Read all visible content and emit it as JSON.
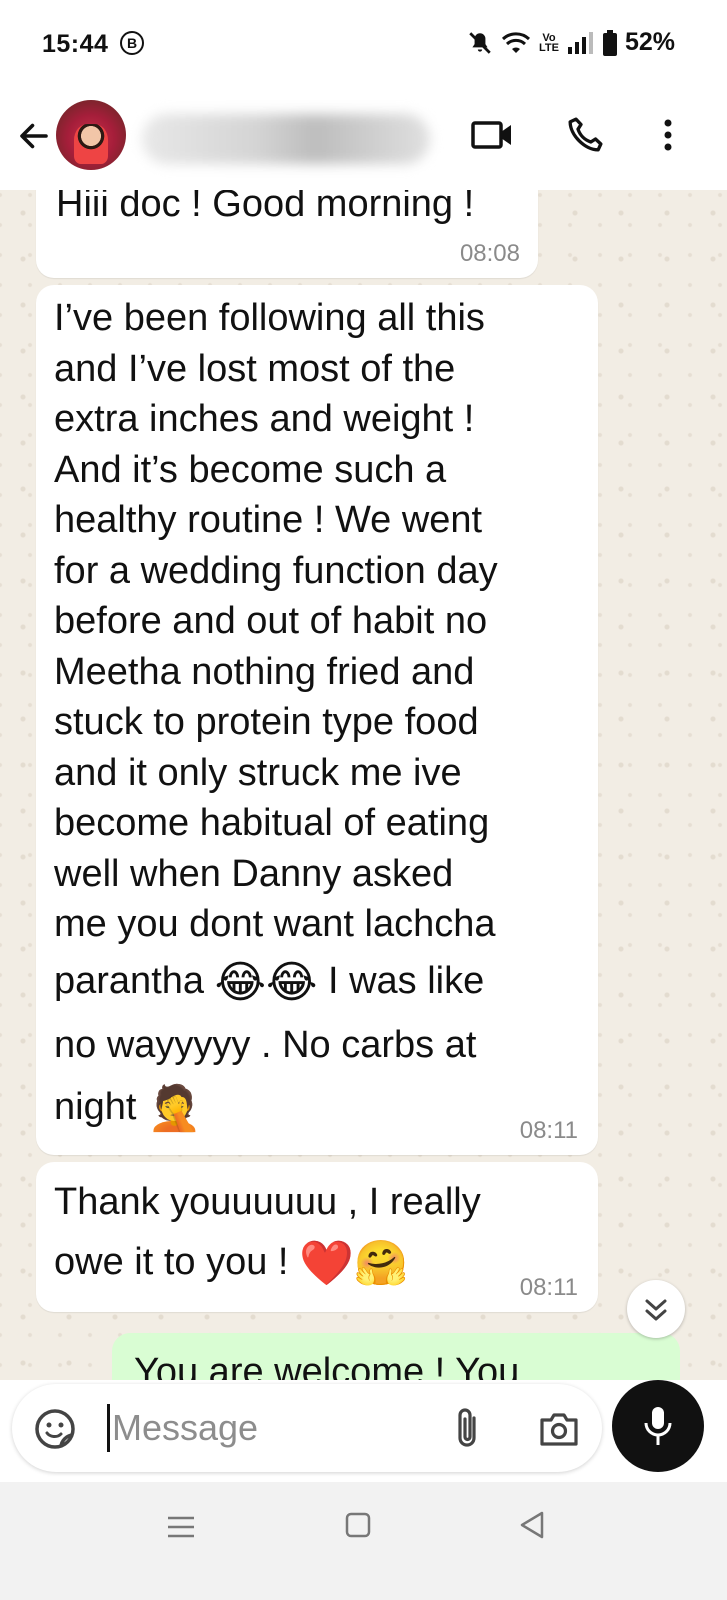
{
  "status_bar": {
    "time": "15:44",
    "badge": "B",
    "volte": "Vo LTE",
    "battery": "52%"
  },
  "header": {
    "back_icon": "arrow-left-icon",
    "video_icon": "video-camera-icon",
    "call_icon": "phone-icon",
    "menu_icon": "more-vertical-icon"
  },
  "messages": [
    {
      "direction": "incoming",
      "text": "Hiii doc ! Good morning !",
      "time": "08:08"
    },
    {
      "direction": "incoming",
      "lines": [
        "I’ve been following all this",
        "and I’ve lost most of the",
        "extra inches and weight !",
        "And it’s become such a",
        "healthy routine ! We went",
        "for a wedding function day",
        "before and out of habit no",
        "Meetha nothing fried and",
        "stuck to protein type food",
        "and it only struck me ive",
        "become habitual of eating",
        "well when Danny asked",
        "me you dont want lachcha"
      ],
      "line14_text": "parantha",
      "line14_emoji": "😂😂",
      "line14_after": "I was like",
      "line15": "no wayyyyy . No carbs at",
      "line16_text": "night",
      "line16_emoji": "🤦",
      "time": "08:11"
    },
    {
      "direction": "incoming",
      "line1": "Thank youuuuuu , I really",
      "line2_text": "owe it to you !",
      "line2_emoji": "❤️🤗",
      "time": "08:11"
    },
    {
      "direction": "outgoing",
      "text": "You are welcome ! You"
    }
  ],
  "input": {
    "placeholder": "Message",
    "emoji_icon": "sticker-smiley-icon",
    "attach_icon": "paperclip-icon",
    "camera_icon": "camera-icon",
    "mic_icon": "microphone-icon"
  },
  "nav": {
    "recent_icon": "menu-lines-icon",
    "home_icon": "square-home-icon",
    "back_icon": "triangle-back-icon"
  },
  "colors": {
    "chat_bg": "#f2ede4",
    "incoming_bubble": "#ffffff",
    "outgoing_bubble": "#d9fdd3",
    "timestamp": "#8a8a8a",
    "mic_button": "#111111"
  }
}
